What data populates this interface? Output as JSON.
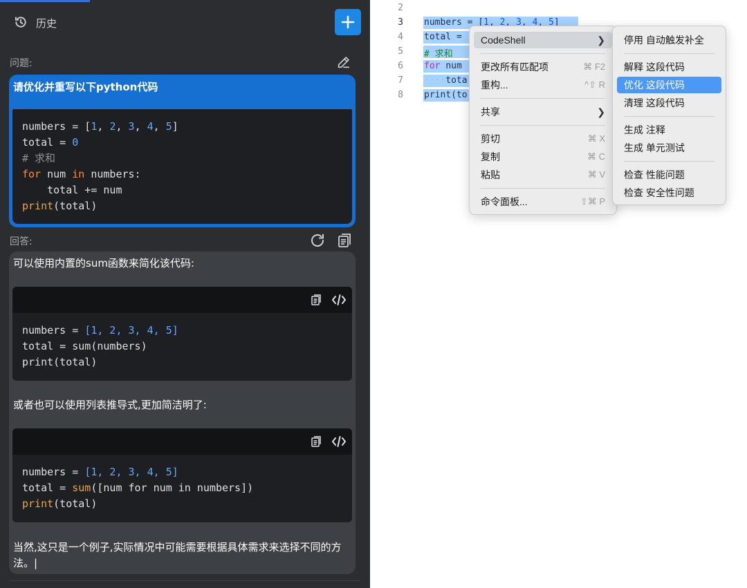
{
  "panel": {
    "history_label": "历史",
    "question_label": "问题:",
    "answer_label": "回答:",
    "question_text": "请优化并重写以下python代码",
    "question_code": [
      [
        [
          "numbers = [",
          ""
        ],
        [
          "1",
          "num"
        ],
        [
          ", ",
          ""
        ],
        [
          "2",
          "num"
        ],
        [
          ", ",
          ""
        ],
        [
          "3",
          "num"
        ],
        [
          ", ",
          ""
        ],
        [
          "4",
          "num"
        ],
        [
          ", ",
          ""
        ],
        [
          "5",
          "num"
        ],
        [
          "]",
          ""
        ]
      ],
      [
        [
          "total = ",
          ""
        ],
        [
          "0",
          "num"
        ]
      ],
      [
        [
          "# 求和",
          "cmt"
        ]
      ],
      [
        [
          "for",
          "kw"
        ],
        [
          " num ",
          ""
        ],
        [
          "in",
          "kw"
        ],
        [
          " numbers:",
          ""
        ]
      ],
      [
        [
          "    total += num",
          ""
        ]
      ],
      [
        [
          "print",
          "fn"
        ],
        [
          "(total)",
          ""
        ]
      ]
    ],
    "answer_intro": "可以使用内置的sum函数来简化该代码:",
    "answer_code_1": [
      [
        [
          "numbers = ",
          ""
        ],
        [
          "[1, 2, 3, 4, 5]",
          "num"
        ]
      ],
      [
        [
          "total = sum(numbers)",
          ""
        ]
      ],
      [
        [
          "print(total)",
          ""
        ]
      ]
    ],
    "answer_middle": "或者也可以使用列表推导式,更加简洁明了:",
    "answer_code_2": [
      [
        [
          "numbers = ",
          ""
        ],
        [
          "[1, 2, 3, 4, 5]",
          "num"
        ]
      ],
      [
        [
          "total = ",
          ""
        ],
        [
          "sum",
          "fn"
        ],
        [
          "([num for num in numbers])",
          ""
        ]
      ],
      [
        [
          "print",
          "fn"
        ],
        [
          "(total)",
          ""
        ]
      ]
    ],
    "answer_outro": "当然,这只是一个例子,实际情况中可能需要根据具体需求来选择不同的方法。|"
  },
  "editor": {
    "line_numbers": [
      "2",
      "3",
      "4",
      "5",
      "6",
      "7",
      "8"
    ],
    "current_line": "3",
    "lines": [
      "",
      "numbers = [1, 2, 3, 4, 5]",
      "total = ",
      "# 求和",
      "for num",
      "····tota",
      "print(to"
    ]
  },
  "context_menu": {
    "items": [
      {
        "label": "CodeShell",
        "shortcut": "",
        "submenu": true
      },
      {
        "label": "更改所有匹配项",
        "shortcut": "⌘ F2"
      },
      {
        "label": "重构...",
        "shortcut": "^⇧ R"
      },
      {
        "label": "共享",
        "shortcut": "",
        "submenu": true
      },
      {
        "label": "剪切",
        "shortcut": "⌘ X"
      },
      {
        "label": "复制",
        "shortcut": "⌘ C"
      },
      {
        "label": "粘贴",
        "shortcut": "⌘ V"
      },
      {
        "label": "命令面板...",
        "shortcut": "⇧⌘ P"
      }
    ]
  },
  "submenu": {
    "items": [
      "停用 自动触发补全",
      "解释 这段代码",
      "优化 这段代码",
      "清理 这段代码",
      "生成 注释",
      "生成 单元测试",
      "检查 性能问题",
      "检查 安全性问题"
    ],
    "active_item": "优化 这段代码"
  },
  "colors": {
    "panel_bg": "#2b2d30",
    "accent_blue": "#1670d2",
    "new_button": "#1e88e5",
    "selection": "#a6d2ff",
    "menu_highlight": "#4c98f7"
  }
}
